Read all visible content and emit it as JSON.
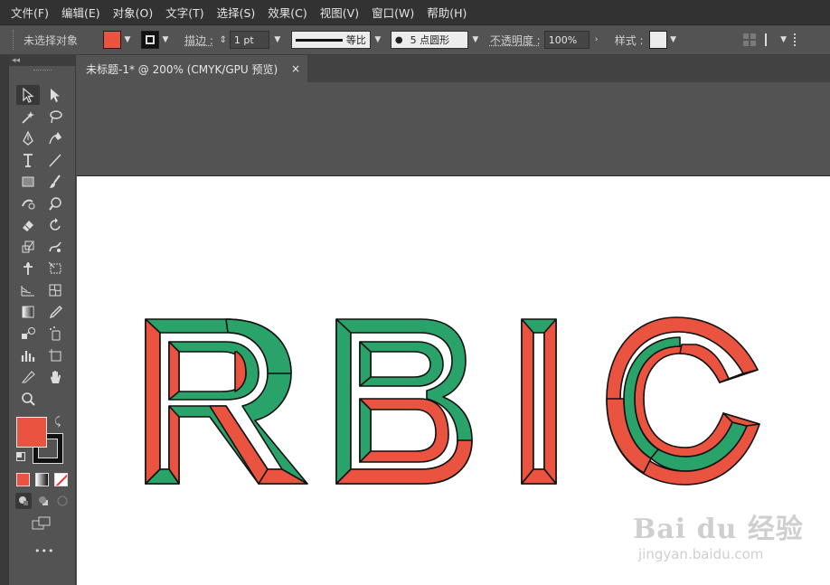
{
  "menu": {
    "file": "文件(F)",
    "edit": "编辑(E)",
    "object": "对象(O)",
    "type": "文字(T)",
    "select": "选择(S)",
    "effect": "效果(C)",
    "view": "视图(V)",
    "window": "窗口(W)",
    "help": "帮助(H)"
  },
  "control": {
    "selection_status": "未选择对象",
    "stroke_label": "描边 :",
    "stroke_weight": "1 pt",
    "profile_label": "等比",
    "brush_label": "5 点圆形",
    "opacity_label": "不透明度 :",
    "opacity_value": "100%",
    "style_label": "样式 :"
  },
  "colors": {
    "fill": "#e9533f",
    "stroke": "#000000",
    "green": "#2aa36b",
    "red": "#e9533f"
  },
  "panel": {
    "collapse": "◂◂"
  },
  "document": {
    "tab_title": "未标题-1* @ 200% (CMYK/GPU 预览)",
    "close": "×"
  },
  "artwork": {
    "letters": [
      "R",
      "B",
      "I",
      "C"
    ]
  },
  "watermark": {
    "brand": "Bai du 经验",
    "url": "jingyan.baidu.com"
  },
  "toolbar": {
    "more": "•••",
    "tools": [
      "selection-tool",
      "direct-selection-tool",
      "magic-wand-tool",
      "lasso-tool",
      "pen-tool",
      "curvature-tool",
      "type-tool",
      "line-segment-tool",
      "rectangle-tool",
      "paintbrush-tool",
      "shaper-tool",
      "blob-brush-tool",
      "eraser-tool",
      "rotate-tool",
      "scale-tool",
      "warp-tool",
      "puppet-warp-tool",
      "free-transform-tool",
      "perspective-grid-tool",
      "mesh-tool",
      "gradient-tool",
      "eyedropper-tool",
      "blend-tool",
      "symbol-sprayer-tool",
      "column-graph-tool",
      "artboard-tool",
      "slice-tool",
      "hand-tool",
      "zoom-tool"
    ]
  }
}
